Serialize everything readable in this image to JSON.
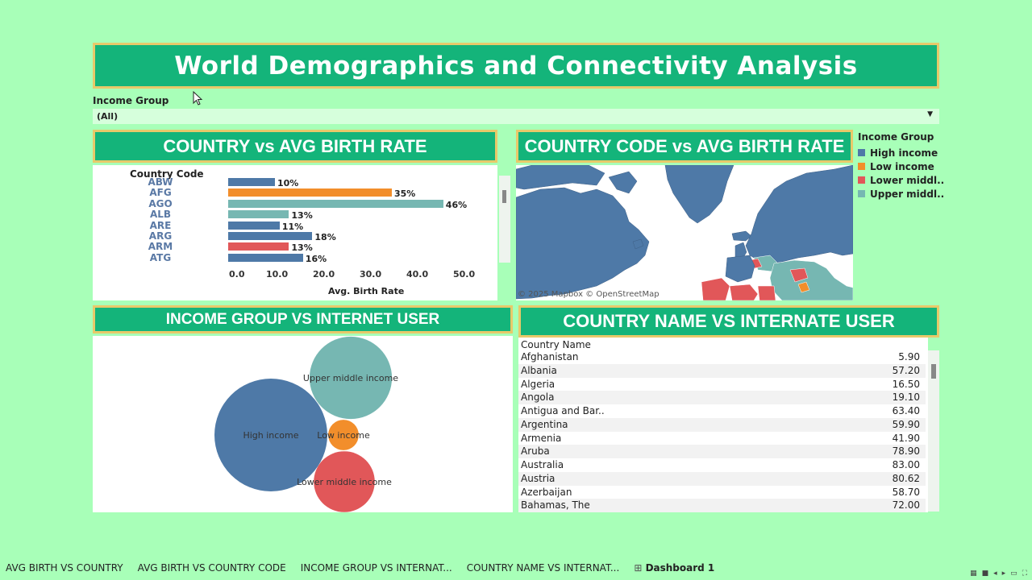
{
  "title": "World Demographics and Connectivity Analysis",
  "filter": {
    "label": "Income Group",
    "value": "(All)"
  },
  "panels": {
    "birth_country": "COUNTRY vs AVG BIRTH RATE",
    "birth_code": "COUNTRY CODE vs AVG BIRTH RATE",
    "income_internet": "INCOME GROUP VS INTERNET USER",
    "country_internet": "COUNTRY NAME VS INTERNATE USER"
  },
  "colors": {
    "high_income": "#4e79a7",
    "low_income": "#f28e2b",
    "lower_middle": "#e15759",
    "upper_middle": "#76b7b2",
    "header_bg": "#14b47a",
    "header_border": "#e8c96a"
  },
  "chart_data": [
    {
      "type": "bar",
      "title": "",
      "orientation": "horizontal",
      "column_header": "Country Code",
      "categories": [
        "ABW",
        "AFG",
        "AGO",
        "ALB",
        "ARE",
        "ARG",
        "ARM",
        "ATG"
      ],
      "values": [
        10,
        35,
        46,
        13,
        11,
        18,
        13,
        16
      ],
      "data_labels": [
        "10%",
        "35%",
        "46%",
        "13%",
        "11%",
        "18%",
        "13%",
        "16%"
      ],
      "income_group": [
        "High income",
        "Low income",
        "Upper middl..",
        "Upper middl..",
        "High income",
        "High income",
        "Lower middl..",
        "High income"
      ],
      "xlabel": "Avg. Birth Rate",
      "x_ticks": [
        "0.0",
        "10.0",
        "20.0",
        "30.0",
        "40.0",
        "50.0"
      ],
      "xlim": [
        0,
        55
      ]
    },
    {
      "type": "bubble",
      "title": "",
      "categories": [
        "High income",
        "Upper middle income",
        "Low income",
        "Lower middle income"
      ],
      "relative_size": [
        100,
        73,
        27,
        54
      ]
    }
  ],
  "map": {
    "attribution": "© 2025 Mapbox © OpenStreetMap"
  },
  "legend": {
    "title": "Income Group",
    "items": [
      "High income",
      "Low income",
      "Lower middl..",
      "Upper middl.."
    ]
  },
  "table": {
    "header": "Country Name",
    "rows": [
      {
        "name": "Afghanistan",
        "value": "5.90"
      },
      {
        "name": "Albania",
        "value": "57.20"
      },
      {
        "name": "Algeria",
        "value": "16.50"
      },
      {
        "name": "Angola",
        "value": "19.10"
      },
      {
        "name": "Antigua and Bar..",
        "value": "63.40"
      },
      {
        "name": "Argentina",
        "value": "59.90"
      },
      {
        "name": "Armenia",
        "value": "41.90"
      },
      {
        "name": "Aruba",
        "value": "78.90"
      },
      {
        "name": "Australia",
        "value": "83.00"
      },
      {
        "name": "Austria",
        "value": "80.62"
      },
      {
        "name": "Azerbaijan",
        "value": "58.70"
      },
      {
        "name": "Bahamas, The",
        "value": "72.00"
      }
    ]
  },
  "tabs": [
    {
      "label": "AVG BIRTH VS COUNTRY",
      "active": false
    },
    {
      "label": "AVG BIRTH VS COUNTRY CODE",
      "active": false
    },
    {
      "label": "INCOME GROUP VS INTERNAT...",
      "active": false
    },
    {
      "label": "COUNTRY NAME VS INTERNAT...",
      "active": false
    },
    {
      "label": "Dashboard 1",
      "active": true
    }
  ]
}
